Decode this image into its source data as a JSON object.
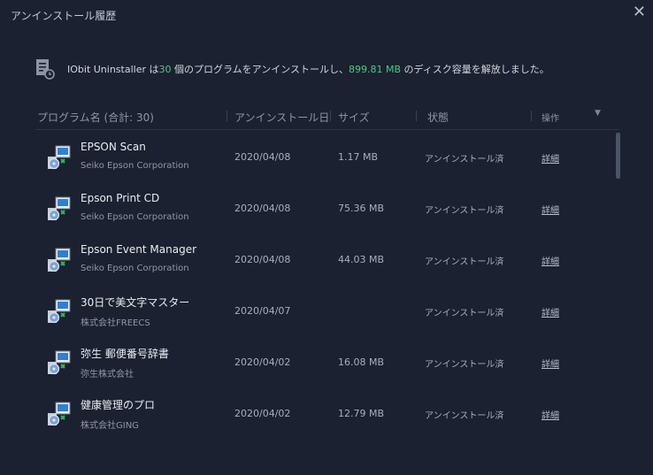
{
  "window": {
    "title": "アンインストール履歴",
    "close_glyph": "✕"
  },
  "summary": {
    "prefix": "IObit Uninstaller は",
    "count": "30",
    "mid": "個のプログラムをアンインストールし、",
    "size": "899.81 MB",
    "suffix": "のディスク容量を解放しました。",
    "icon": "document-clock-icon",
    "highlight_color": "#3bd07f"
  },
  "table": {
    "headers": {
      "program": "プログラム名 (合計: 30)",
      "date": "アンインストール日",
      "size": "サイズ",
      "status": "状態",
      "action": "操作"
    },
    "sort_glyph": "▼",
    "rows": [
      {
        "name": "EPSON Scan",
        "publisher": "Seiko Epson Corporation",
        "date": "2020/04/08",
        "size": "1.17 MB",
        "status": "アンインストール済",
        "action": "詳細"
      },
      {
        "name": "Epson Print CD",
        "publisher": "Seiko Epson Corporation",
        "date": "2020/04/08",
        "size": "75.36 MB",
        "status": "アンインストール済",
        "action": "詳細"
      },
      {
        "name": "Epson Event Manager",
        "publisher": "Seiko Epson Corporation",
        "date": "2020/04/08",
        "size": "44.03 MB",
        "status": "アンインストール済",
        "action": "詳細"
      },
      {
        "name": "30日で美文字マスター",
        "publisher": "株式会社FREECS",
        "date": "2020/04/07",
        "size": "",
        "status": "アンインストール済",
        "action": "詳細"
      },
      {
        "name": "弥生 郵便番号辞書",
        "publisher": "弥生株式会社",
        "date": "2020/04/02",
        "size": "16.08 MB",
        "status": "アンインストール済",
        "action": "詳細"
      },
      {
        "name": "健康管理のプロ",
        "publisher": "株式会社GING",
        "date": "2020/04/02",
        "size": "12.79 MB",
        "status": "アンインストール済",
        "action": "詳細"
      }
    ]
  },
  "colors": {
    "background": "#1b2130",
    "text": "#c9ced8",
    "accent": "#3bd07f"
  },
  "icons": {
    "row_icon": "installer-package-icon"
  }
}
